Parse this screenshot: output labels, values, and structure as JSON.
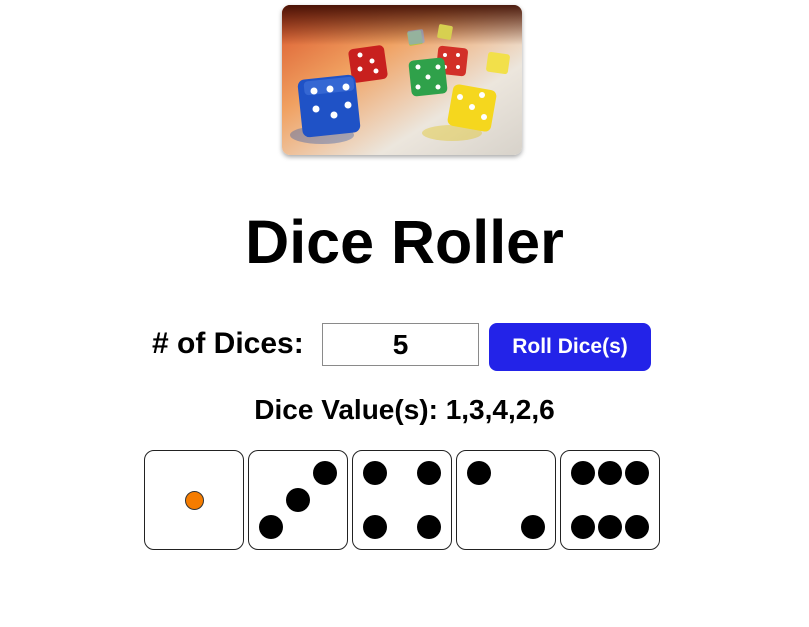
{
  "header": {
    "image_description_icon": "colorful-dice-photo"
  },
  "title": "Dice Roller",
  "controls": {
    "count_label": "# of Dices:",
    "count_value": "5",
    "roll_button_label": "Roll Dice(s)"
  },
  "results": {
    "prefix": "Dice Value(s):",
    "values_text": "1,3,4,2,6",
    "line": "Dice Value(s): 1,3,4,2,6"
  },
  "dice": [
    {
      "value": 1,
      "pip_color": "#f57c00"
    },
    {
      "value": 3,
      "pip_color": "#000000"
    },
    {
      "value": 4,
      "pip_color": "#000000"
    },
    {
      "value": 2,
      "pip_color": "#000000"
    },
    {
      "value": 6,
      "pip_color": "#000000"
    }
  ],
  "colors": {
    "button_background": "#2323e8",
    "button_text": "#ffffff",
    "single_pip": "#f57c00"
  }
}
